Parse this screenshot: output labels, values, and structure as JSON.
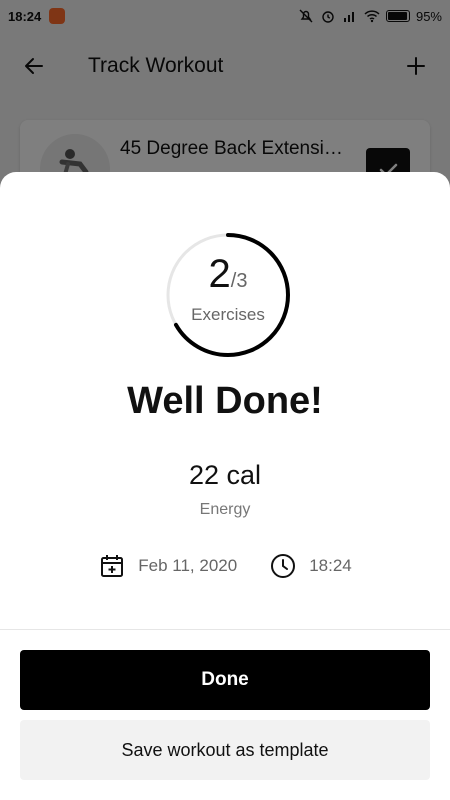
{
  "status_bar": {
    "time": "18:24",
    "battery": "95%",
    "icons": [
      "app-notification-icon",
      "mute-icon",
      "alarm-icon",
      "signal-icon",
      "wifi-icon",
      "battery-icon"
    ]
  },
  "app_bar": {
    "title": "Track Workout",
    "back_icon": "arrow-left-icon",
    "add_icon": "plus-icon"
  },
  "exercise_card": {
    "name": "45 Degree Back Extensi…",
    "checked": true
  },
  "summary": {
    "completed": "2",
    "total": "/3",
    "progress": 0.6667,
    "label": "Exercises",
    "headline": "Well Done!",
    "energy_value": "22 cal",
    "energy_label": "Energy",
    "date": "Feb 11, 2020",
    "time": "18:24"
  },
  "actions": {
    "done_label": "Done",
    "template_label": "Save workout as template"
  },
  "colors": {
    "primary": "#000000",
    "secondary_button": "#f2f2f2",
    "muted_text": "#666666",
    "status_app": "#ff6a2b"
  }
}
